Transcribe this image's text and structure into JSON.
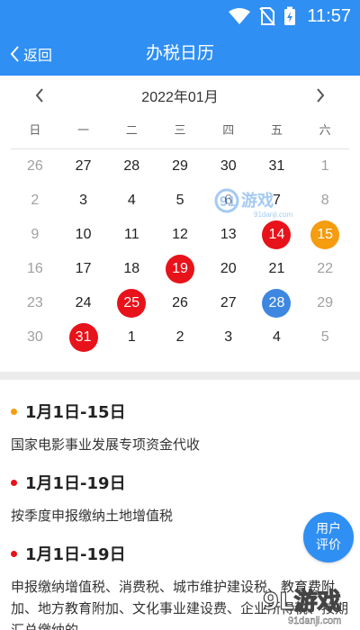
{
  "status_bar": {
    "time": "11:57"
  },
  "header": {
    "back_label": "返回",
    "title": "办税日历"
  },
  "calendar": {
    "month_label": "2022年01月",
    "weekdays": [
      "日",
      "一",
      "二",
      "三",
      "四",
      "五",
      "六"
    ],
    "weeks": [
      [
        {
          "d": "26",
          "other": true
        },
        {
          "d": "27"
        },
        {
          "d": "28"
        },
        {
          "d": "29"
        },
        {
          "d": "30"
        },
        {
          "d": "31"
        },
        {
          "d": "1",
          "other": true
        }
      ],
      [
        {
          "d": "2",
          "other": true
        },
        {
          "d": "3"
        },
        {
          "d": "4"
        },
        {
          "d": "5"
        },
        {
          "d": "6"
        },
        {
          "d": "7"
        },
        {
          "d": "8",
          "other": true
        }
      ],
      [
        {
          "d": "9",
          "other": true
        },
        {
          "d": "10"
        },
        {
          "d": "11"
        },
        {
          "d": "12"
        },
        {
          "d": "13"
        },
        {
          "d": "14",
          "mark": "red"
        },
        {
          "d": "15",
          "mark": "orange"
        }
      ],
      [
        {
          "d": "16",
          "other": true
        },
        {
          "d": "17"
        },
        {
          "d": "18"
        },
        {
          "d": "19",
          "mark": "red"
        },
        {
          "d": "20"
        },
        {
          "d": "21"
        },
        {
          "d": "22",
          "other": true
        }
      ],
      [
        {
          "d": "23",
          "other": true
        },
        {
          "d": "24"
        },
        {
          "d": "25",
          "mark": "red"
        },
        {
          "d": "26"
        },
        {
          "d": "27"
        },
        {
          "d": "28",
          "mark": "blue"
        },
        {
          "d": "29",
          "other": true
        }
      ],
      [
        {
          "d": "30",
          "other": true
        },
        {
          "d": "31",
          "mark": "red"
        },
        {
          "d": "1"
        },
        {
          "d": "2"
        },
        {
          "d": "3"
        },
        {
          "d": "4"
        },
        {
          "d": "5",
          "other": true
        }
      ]
    ]
  },
  "events": [
    {
      "date": "1月1日-15日",
      "dot_color": "#f59c0f",
      "desc": "国家电影事业发展专项资金代收"
    },
    {
      "date": "1月1日-19日",
      "dot_color": "#e8121a",
      "desc": "按季度申报缴纳土地增值税"
    },
    {
      "date": "1月1日-19日",
      "dot_color": "#e8121a",
      "desc": "申报缴纳增值税、消费税、城市维护建设税、教育费附加、地方教育附加、文化事业建设费、企业所得税、按期汇总缴纳的..."
    }
  ],
  "feedback": {
    "line1": "用户",
    "line2": "评价"
  },
  "watermark": {
    "center_text": "91游戏",
    "center_url": "91danji.com",
    "bottom_text": "9L游戏",
    "bottom_url": "91danji.com"
  },
  "colors": {
    "primary": "#2f8ff3",
    "red": "#e8121a",
    "orange": "#f59c0f",
    "blue": "#3e87e0"
  }
}
